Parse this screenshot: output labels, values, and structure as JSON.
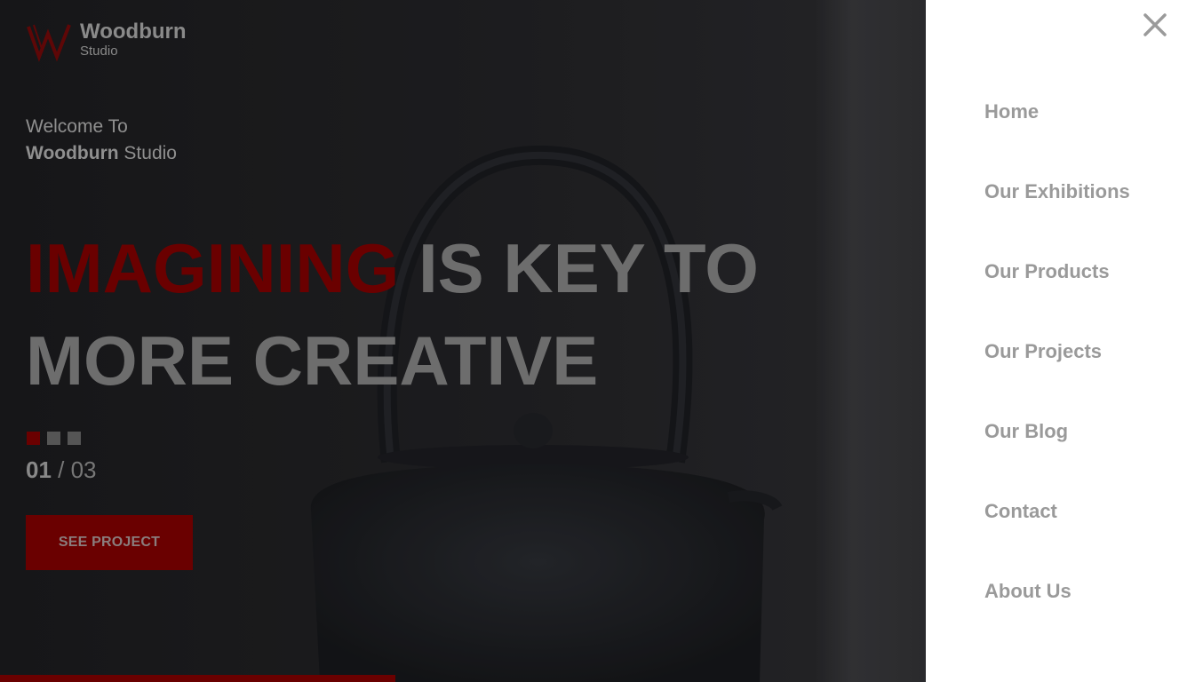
{
  "brand": {
    "mark": "W",
    "name": "Woodburn",
    "sub": "Studio"
  },
  "welcome": {
    "line1": "Welcome To",
    "bold": "Woodburn",
    "rest": " Studio"
  },
  "headline": {
    "accent": "IMAGINING",
    "line1_rest": " IS KEY TO",
    "line2": "MORE CREATIVE"
  },
  "slider": {
    "current": "01",
    "separator": " / ",
    "total": "03",
    "active_index": 0
  },
  "cta": {
    "label": "SEE PROJECT"
  },
  "menu": {
    "close_icon": "close-icon",
    "items": [
      {
        "label": "Home"
      },
      {
        "label": "Our Exhibitions"
      },
      {
        "label": "Our Products"
      },
      {
        "label": "Our Projects"
      },
      {
        "label": "Our Blog"
      },
      {
        "label": "Contact"
      },
      {
        "label": "About Us"
      }
    ]
  },
  "colors": {
    "accent": "#6a0000",
    "menu_bg": "#ffffff",
    "menu_text": "#9a9a9a"
  }
}
